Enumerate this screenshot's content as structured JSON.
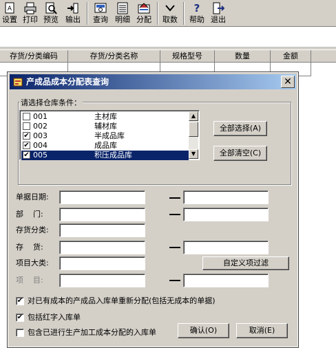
{
  "toolbar": {
    "buttons": [
      {
        "label": "设置",
        "icon": "settings-icon"
      },
      {
        "label": "打印",
        "icon": "print-icon"
      },
      {
        "label": "预览",
        "icon": "preview-icon"
      },
      {
        "label": "输出",
        "icon": "export-icon"
      },
      {
        "label": "查询",
        "icon": "query-icon"
      },
      {
        "label": "明细",
        "icon": "detail-icon"
      },
      {
        "label": "分配",
        "icon": "allocate-icon"
      },
      {
        "label": "取数",
        "icon": "fetch-data-icon"
      },
      {
        "label": "帮助",
        "icon": "help-icon"
      },
      {
        "label": "退出",
        "icon": "exit-icon"
      }
    ]
  },
  "grid": {
    "columns": [
      "存货/分类编码",
      "存货/分类名称",
      "规格型号",
      "数量",
      "金额"
    ]
  },
  "dialog": {
    "title": "产成品成本分配表查询",
    "close_label": "✕",
    "warehouse_group_label": "请选择仓库条件：",
    "warehouses": [
      {
        "code": "001",
        "name": "主材库",
        "checked": false,
        "selected": false
      },
      {
        "code": "002",
        "name": "辅材库",
        "checked": false,
        "selected": false
      },
      {
        "code": "003",
        "name": "半成品库",
        "checked": true,
        "selected": false
      },
      {
        "code": "004",
        "name": "成品库",
        "checked": true,
        "selected": false
      },
      {
        "code": "005",
        "name": "积压成品库",
        "checked": true,
        "selected": true
      }
    ],
    "select_all_label": "全部选择(A)",
    "clear_all_label": "全部清空(C)",
    "fields": {
      "doc_date_label": "单据日期:",
      "department_label": "部    门:",
      "inventory_category_label": "存货分类:",
      "inventory_label": "存    货:",
      "project_category_label": "项目大类:",
      "project_label": "项    目:",
      "doc_date_from": "",
      "doc_date_to": "",
      "department_from": "",
      "department_to": "",
      "inventory_category": "",
      "inventory_from": "",
      "inventory_to": "",
      "project_category": "",
      "project_from": "",
      "project_to": ""
    },
    "custom_filter_label": "自定义项过滤",
    "options": [
      {
        "label": "对已有成本的产成品入库单重新分配(包括无成本的单据)",
        "checked": true
      },
      {
        "label": "包括红字入库单",
        "checked": true
      },
      {
        "label": "包含已进行生产加工成本分配的入库单",
        "checked": false
      }
    ],
    "ok_label": "确认(O)",
    "cancel_label": "取消(E)"
  }
}
